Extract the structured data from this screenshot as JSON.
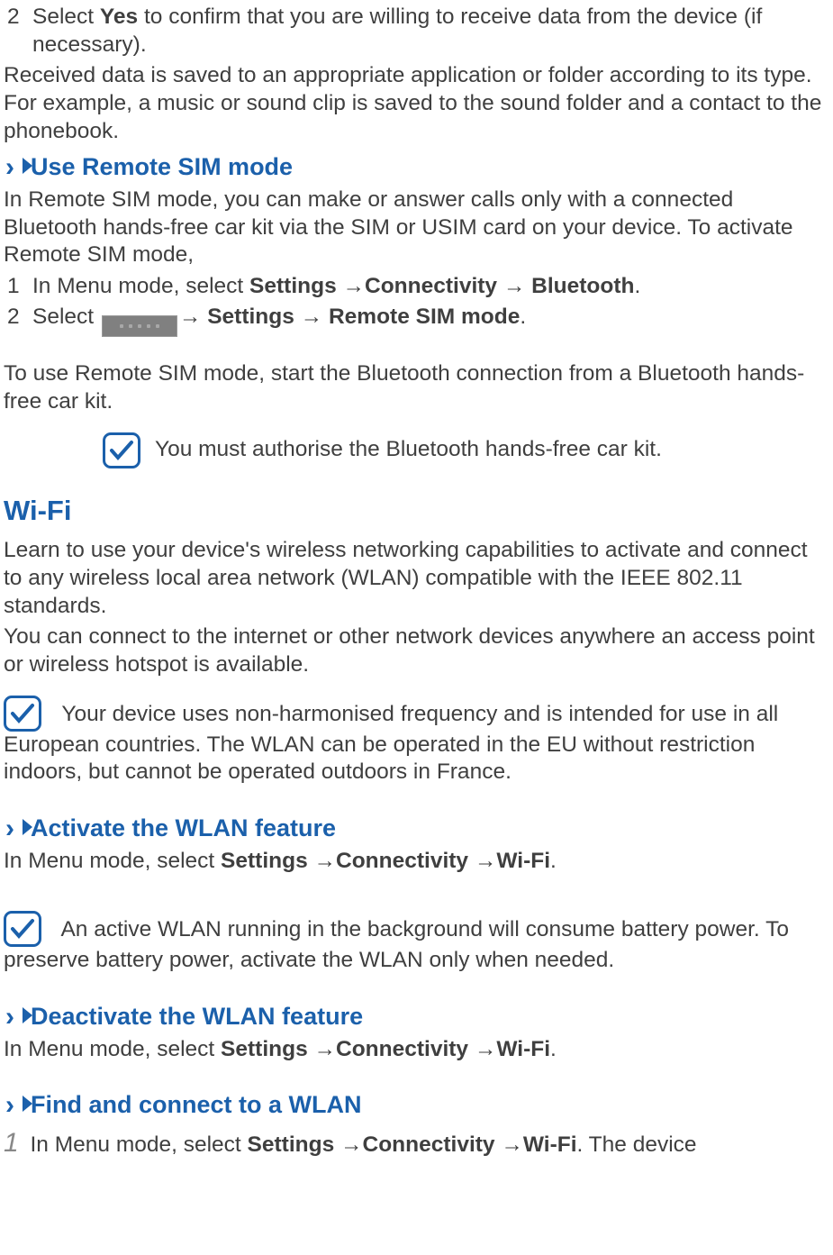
{
  "list_yes": {
    "num": "2",
    "t1": "Select ",
    "bold": "Yes",
    "t2": " to confirm that you are willing to receive data from the device (if necessary)."
  },
  "para_received": "Received data is saved to an appropriate application or folder according to its type. For example, a music or sound clip is saved to the sound folder and a contact to the phonebook.",
  "h_remote": "Use Remote SIM mode",
  "para_remote_intro": "In Remote SIM mode, you can make or answer calls only with a connected Bluetooth hands-free car kit via the SIM or USIM card on your device. To activate Remote SIM mode,",
  "remote_step1": {
    "num": "1",
    "t1": "In Menu mode, select ",
    "b1": "Settings ",
    "arr1": "→",
    "b2": "Connectivity ",
    "arr2": "→",
    "b3": " Bluetooth",
    "t2": "."
  },
  "remote_step2": {
    "num": "2",
    "t1": "Select  ",
    "arr1": "→",
    "b1": " Settings ",
    "arr2": "→",
    "b2": " Remote SIM mode",
    "t2": "."
  },
  "para_remote_use": "To use Remote SIM mode, start the Bluetooth connection from a Bluetooth hands-free car kit.",
  "note_auth": "You must authorise the Bluetooth hands-free car kit.",
  "h_wifi": "Wi-Fi",
  "para_wifi1": "Learn to use your device's wireless networking capabilities to activate and connect to any wireless local area network (WLAN) compatible with the IEEE 802.11 standards.",
  "para_wifi2": "You can connect to the internet or other network devices anywhere an access point or wireless hotspot is available.",
  "note_freq": "Your device uses non-harmonised frequency and is intended for use in all European countries. The WLAN can be operated in the EU without restriction indoors, but cannot be operated outdoors in France.",
  "h_activate": "Activate the WLAN feature",
  "activate_para": {
    "t1": "In Menu mode, select ",
    "b1": "Settings ",
    "arr1": "→",
    "b2": "Connectivity ",
    "arr2": "→",
    "b3": "Wi-Fi",
    "t2": "."
  },
  "note_battery": "An active WLAN running in the background will consume battery power. To preserve battery power, activate the WLAN only when needed.",
  "h_deactivate": "Deactivate the WLAN feature",
  "deactivate_para": {
    "t1": "In Menu mode, select ",
    "b1": "Settings ",
    "arr1": "→",
    "b2": "Connectivity ",
    "arr2": "→",
    "b3": "Wi-Fi",
    "t2": "."
  },
  "h_find": "Find and connect to a WLAN",
  "find_step": {
    "num": "1",
    "t1": " In Menu mode, select ",
    "b1": "Settings ",
    "arr1": "→",
    "b2": "Connectivity ",
    "arr2": "→",
    "b3": "Wi-Fi",
    "t2": ". The device"
  }
}
